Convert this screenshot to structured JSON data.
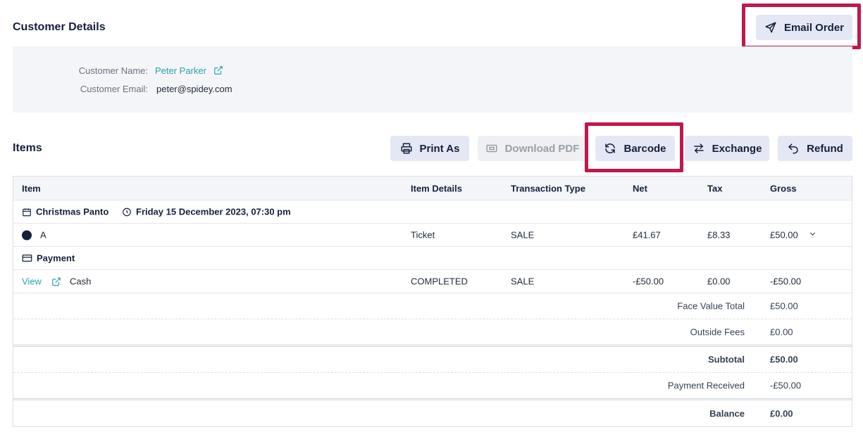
{
  "customer": {
    "title": "Customer Details",
    "email_order_label": "Email Order",
    "name_label": "Customer Name:",
    "name_value": "Peter Parker",
    "email_label": "Customer Email:",
    "email_value": "peter@spidey.com"
  },
  "items": {
    "title": "Items",
    "actions": {
      "print_label": "Print As",
      "download_label": "Download PDF",
      "barcode_label": "Barcode",
      "exchange_label": "Exchange",
      "refund_label": "Refund"
    },
    "columns": {
      "item": "Item",
      "item_details": "Item Details",
      "transaction_type": "Transaction Type",
      "net": "Net",
      "tax": "Tax",
      "gross": "Gross"
    },
    "event": {
      "name": "Christmas Panto",
      "datetime": "Friday 15 December 2023, 07:30 pm"
    },
    "ticket_row": {
      "item": "A",
      "details": "Ticket",
      "type": "SALE",
      "net": "£41.67",
      "tax": "£8.33",
      "gross": "£50.00"
    },
    "payment_group": "Payment",
    "payment_row": {
      "view_label": "View",
      "method": "Cash",
      "details": "COMPLETED",
      "type": "SALE",
      "net": "-£50.00",
      "tax": "£0.00",
      "gross": "-£50.00"
    },
    "summary": {
      "face_value_label": "Face Value Total",
      "face_value": "£50.00",
      "outside_fees_label": "Outside Fees",
      "outside_fees": "£0.00",
      "subtotal_label": "Subtotal",
      "subtotal": "£50.00",
      "payment_received_label": "Payment Received",
      "payment_received": "-£50.00",
      "balance_label": "Balance",
      "balance": "£0.00"
    }
  },
  "colors": {
    "highlight": "#c0184b",
    "link": "#2aa3a8",
    "button_bg": "#e3e8f4",
    "heading": "#15213a"
  }
}
